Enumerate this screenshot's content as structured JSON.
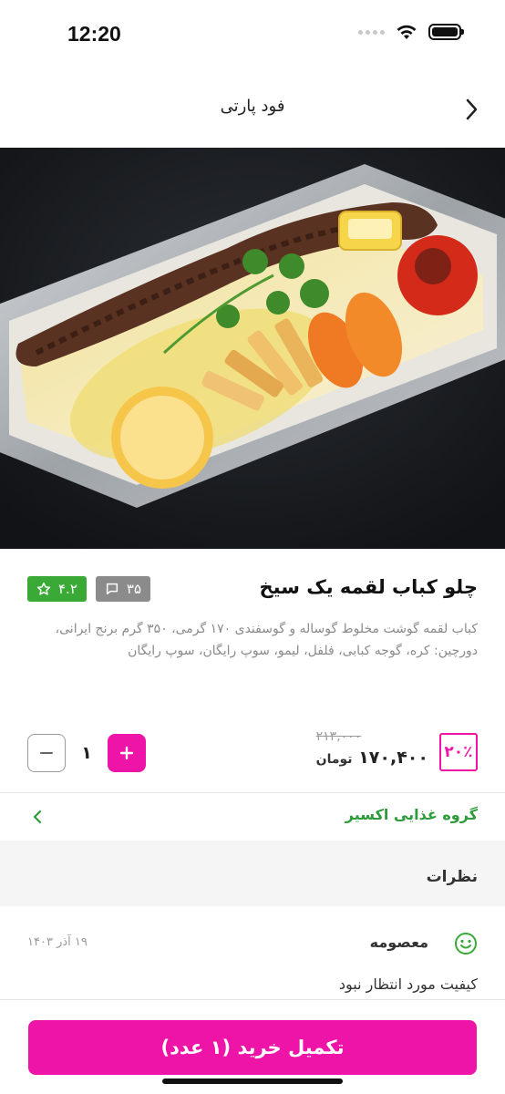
{
  "status_bar": {
    "time": "12:20"
  },
  "nav": {
    "title": "فود پارتی"
  },
  "product": {
    "title": "چلو کباب لقمه یک سیخ",
    "rating": "۴.۲",
    "comments_count": "۳۵",
    "description": "کباب لقمه گوشت مخلوط گوساله و گوسفندی ۱۷۰ گرمی، ۳۵۰ گرم برنج ایرانی، دورچین: کره، گوجه کبابی، فلفل، لیمو، سوپ رایگان، سوپ رایگان",
    "discount": "۲۰٪",
    "old_price": "۲۱۳,۰۰۰",
    "new_price": "۱۷۰,۴۰۰",
    "currency": "تومان",
    "quantity": "۱"
  },
  "vendor": {
    "name": "گروه غذایی اکسیر"
  },
  "reviews": {
    "title": "نظرات",
    "items": [
      {
        "author": "معصومه",
        "date": "۱۹ آذر ۱۴۰۳",
        "text": "کیفیت مورد انتظار نبود"
      }
    ]
  },
  "cta": {
    "label": "تکمیل خرید (۱ عدد)"
  },
  "colors": {
    "accent": "#ef14a8",
    "green": "#3aa936",
    "vendor_green": "#2e9b3a"
  }
}
